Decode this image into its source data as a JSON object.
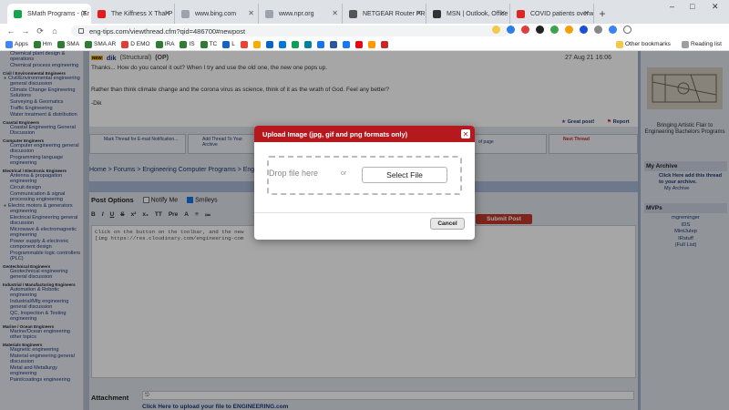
{
  "browser": {
    "tabs": [
      {
        "label": "SMath Programs - (Er",
        "color": "#16a34a",
        "active": true
      },
      {
        "label": "The Kiffness X Thai P",
        "color": "#e11d1d"
      },
      {
        "label": "www.bing.com",
        "color": "#9ca3af"
      },
      {
        "label": "www.npr.org",
        "color": "#9ca3af"
      },
      {
        "label": "NETGEAR Router PRO",
        "color": "#555555"
      },
      {
        "label": "MSN | Outlook, Office",
        "color": "#333333"
      },
      {
        "label": "COVID patients overw",
        "color": "#dc2626"
      }
    ],
    "new_tab_glyph": "+",
    "url": "eng-tips.com/viewthread.cfm?qid=486700#newpost",
    "back_glyph": "←",
    "forward_glyph": "→",
    "reload_glyph": "⟳",
    "window_controls": [
      "–",
      "□",
      "✕"
    ],
    "bookmarks": [
      "Apps",
      "Hm",
      "SMA",
      "SMA AR",
      "D EMO",
      "IRA",
      "IS",
      "TC",
      "L"
    ],
    "other_bookmarks": "Other bookmarks",
    "reading_list": "Reading list"
  },
  "left_sidebar": {
    "groups": [
      {
        "heading": "",
        "items": [
          "Chemical plant design & operations",
          "Chemical process engineering"
        ]
      },
      {
        "heading": "Civil / Environmental Engineers",
        "items": [
          "Civil/Environmental engineering general discussion",
          "Climate Change Engineering Solutions",
          "Surveying & Geomatics",
          "Traffic Engineering",
          "Water treatment & distribution"
        ]
      },
      {
        "heading": "Coastal Engineers",
        "items": [
          "Coastal Engineering General Discussion"
        ]
      },
      {
        "heading": "Computer Engineers",
        "items": [
          "Computer engineering general discussion",
          "Programming language engineering"
        ]
      },
      {
        "heading": "Electrical / Electronic Engineers",
        "items": [
          "Antenna & propagation engineering",
          "Circuit design",
          "Communication & signal processing engineering",
          "Electric motors & generators engineering",
          "Electrical Engineering general discussion",
          "Microwave & electromagnetic engineering",
          "Power supply & electronic component design",
          "Programmable logic controllers (PLC)"
        ]
      },
      {
        "heading": "Geotechnical Engineers",
        "items": [
          "Geotechnical engineering general discussion"
        ]
      },
      {
        "heading": "Industrial / Manufacturing Engineers",
        "items": [
          "Automation & Robotic engineering",
          "Industrial/Mfg engineering general discussion",
          "QC, Inspection & Testing engineering"
        ]
      },
      {
        "heading": "Marine / Ocean Engineers",
        "items": [
          "Marine/Ocean engineering other topics"
        ]
      },
      {
        "heading": "Materials Engineers",
        "items": [
          "Magnetic engineering",
          "Material engineering general discussion",
          "Metal and Metallurgy engineering",
          "Paint/coatings engineering"
        ]
      }
    ]
  },
  "post": {
    "new_badge": "NEW",
    "author": "dik",
    "author_role": "(Structural)",
    "op": "(OP)",
    "date": "27 Aug 21 16:06",
    "body1": "Thanks... How do you cancel it out? When I try and use the old one, the new one pops up.",
    "body2": "Rather than think climate change and the corona virus as science, think of it as the wrath of God. Feel any better?",
    "signature": "-Dik",
    "great_post": "Great post!",
    "report": "Report"
  },
  "actions": {
    "mark_thread": "Mark Thread for E-mail Notification...",
    "add_thread": "Add Thread To Your Archive",
    "of_page": "of page",
    "next_thread": "Next Thread"
  },
  "breadcrumb": {
    "home": "Home",
    "forums": "Forums",
    "engineering_programs": "Engineering Computer Programs",
    "more": "Eng"
  },
  "options": {
    "title": "Post Options",
    "notify_me": "Notify Me",
    "smileys": "Smileys",
    "submit": "Submit Post",
    "editor_line1": "Click on the button on the toolbar, and the new",
    "editor_line2": "[img https://res.cloudinary.com/engineering-com",
    "attachment": "Attachment",
    "upload_link": "Click Here to upload your file to ENGINEERING.com"
  },
  "right_sidebar": {
    "ad_caption": "Bringing Artistic Flair to Engineering Bachelors Programs",
    "archive_heading": "My Archive",
    "archive_text": "Click Here add this thread to your archive.",
    "archive_link": "My Archive",
    "mvps_heading": "MVPs",
    "mvps": [
      "mgreminger",
      "IDS",
      "MintJulep",
      "IRstuff",
      "(Full List)"
    ]
  },
  "modal": {
    "title": "Upload Image (jpg, gif and png formats only)",
    "close": "✕",
    "drop_text": "Drop file here",
    "or": "or",
    "select_button": "Select File",
    "cancel_button": "Cancel"
  },
  "colors": {
    "brand_red": "#b5191d",
    "link_blue": "#1e3a7a",
    "overlay": "rgba(0,0,0,0.35)"
  }
}
